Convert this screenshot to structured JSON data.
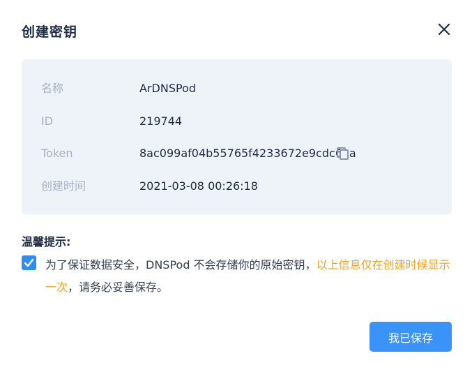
{
  "dialog": {
    "title": "创建密钥",
    "close_icon": "close-icon"
  },
  "info": {
    "rows": [
      {
        "label": "名称",
        "value": "ArDNSPod"
      },
      {
        "label": "ID",
        "value": "219744"
      },
      {
        "label": "Token",
        "value": "8ac099af04b55765f4233672e9cdc6aa"
      },
      {
        "label": "创建时间",
        "value": "2021-03-08 00:26:18"
      }
    ],
    "copy_icon": "copy-icon"
  },
  "tip": {
    "title": "温馨提示:",
    "checked": true,
    "text_before": "为了保证数据安全，DNSPod 不会存储你的原始密钥，",
    "text_highlight": "以上信息仅在创建时候显示一次",
    "text_after": "，请务必妥善保存。"
  },
  "actions": {
    "confirm_label": "我已保存"
  },
  "colors": {
    "primary": "#3a93f6",
    "highlight": "#f0a418",
    "panel_bg": "#eef3fa",
    "label": "#a8b0bf"
  }
}
